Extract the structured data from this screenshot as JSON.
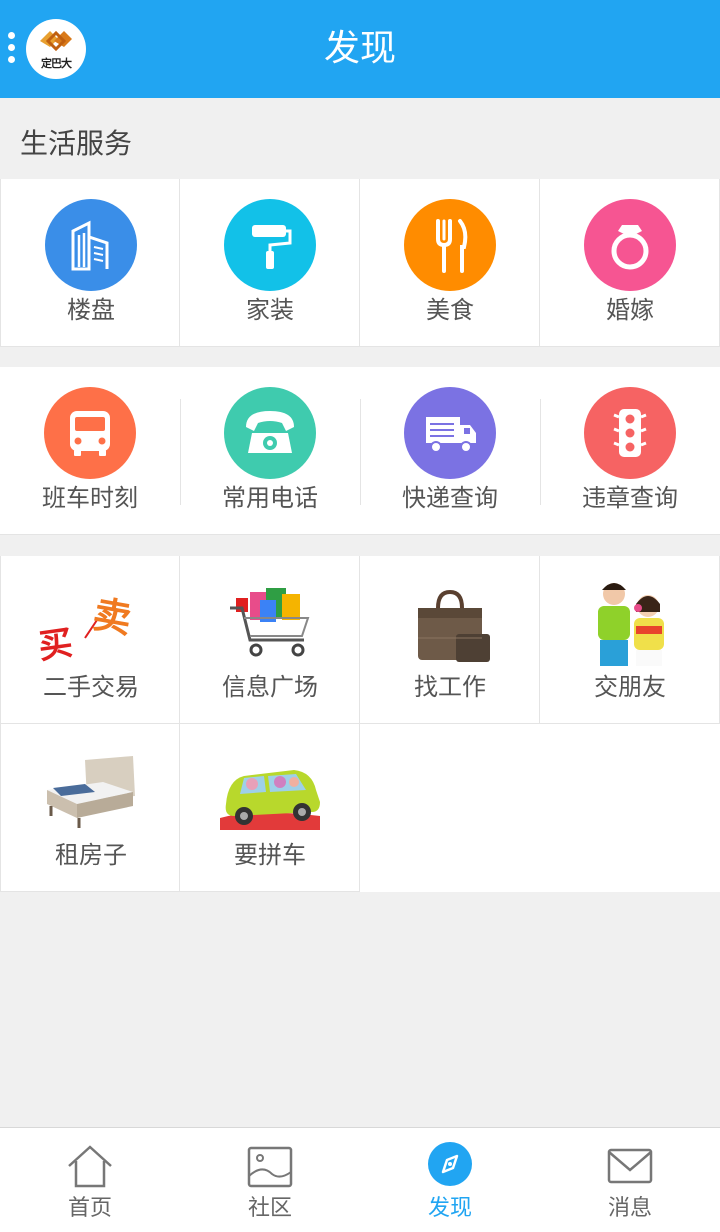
{
  "header": {
    "title": "发现",
    "logo_text": "定巴大"
  },
  "section": {
    "title": "生活服务"
  },
  "services_row1": [
    {
      "label": "楼盘",
      "icon": "buildings-icon",
      "color": "#3a8ee8"
    },
    {
      "label": "家装",
      "icon": "paint-roller-icon",
      "color": "#12c1e8"
    },
    {
      "label": "美食",
      "icon": "fork-knife-icon",
      "color": "#ff8c00"
    },
    {
      "label": "婚嫁",
      "icon": "ring-icon",
      "color": "#f65592"
    }
  ],
  "services_row2": [
    {
      "label": "班车时刻",
      "icon": "bus-icon",
      "color": "#fe7048"
    },
    {
      "label": "常用电话",
      "icon": "telephone-icon",
      "color": "#3fcbae"
    },
    {
      "label": "快递查询",
      "icon": "delivery-truck-icon",
      "color": "#7b72e3"
    },
    {
      "label": "违章查询",
      "icon": "traffic-light-icon",
      "color": "#f66363"
    }
  ],
  "services_row3": [
    {
      "label": "二手交易",
      "icon": "buy-sell-image"
    },
    {
      "label": "信息广场",
      "icon": "shopping-cart-image"
    },
    {
      "label": "找工作",
      "icon": "briefcase-image"
    },
    {
      "label": "交朋友",
      "icon": "friends-image"
    }
  ],
  "services_row4": [
    {
      "label": "租房子",
      "icon": "bed-image"
    },
    {
      "label": "要拼车",
      "icon": "carpool-image"
    }
  ],
  "pic_text": {
    "buy": "买",
    "sell": "卖"
  },
  "bottom_nav": [
    {
      "label": "首页",
      "icon": "home-icon",
      "active": false
    },
    {
      "label": "社区",
      "icon": "image-icon",
      "active": false
    },
    {
      "label": "发现",
      "icon": "compass-icon",
      "active": true
    },
    {
      "label": "消息",
      "icon": "mail-icon",
      "active": false
    }
  ],
  "colors": {
    "primary": "#21a5f2",
    "background": "#f0f0f0"
  }
}
